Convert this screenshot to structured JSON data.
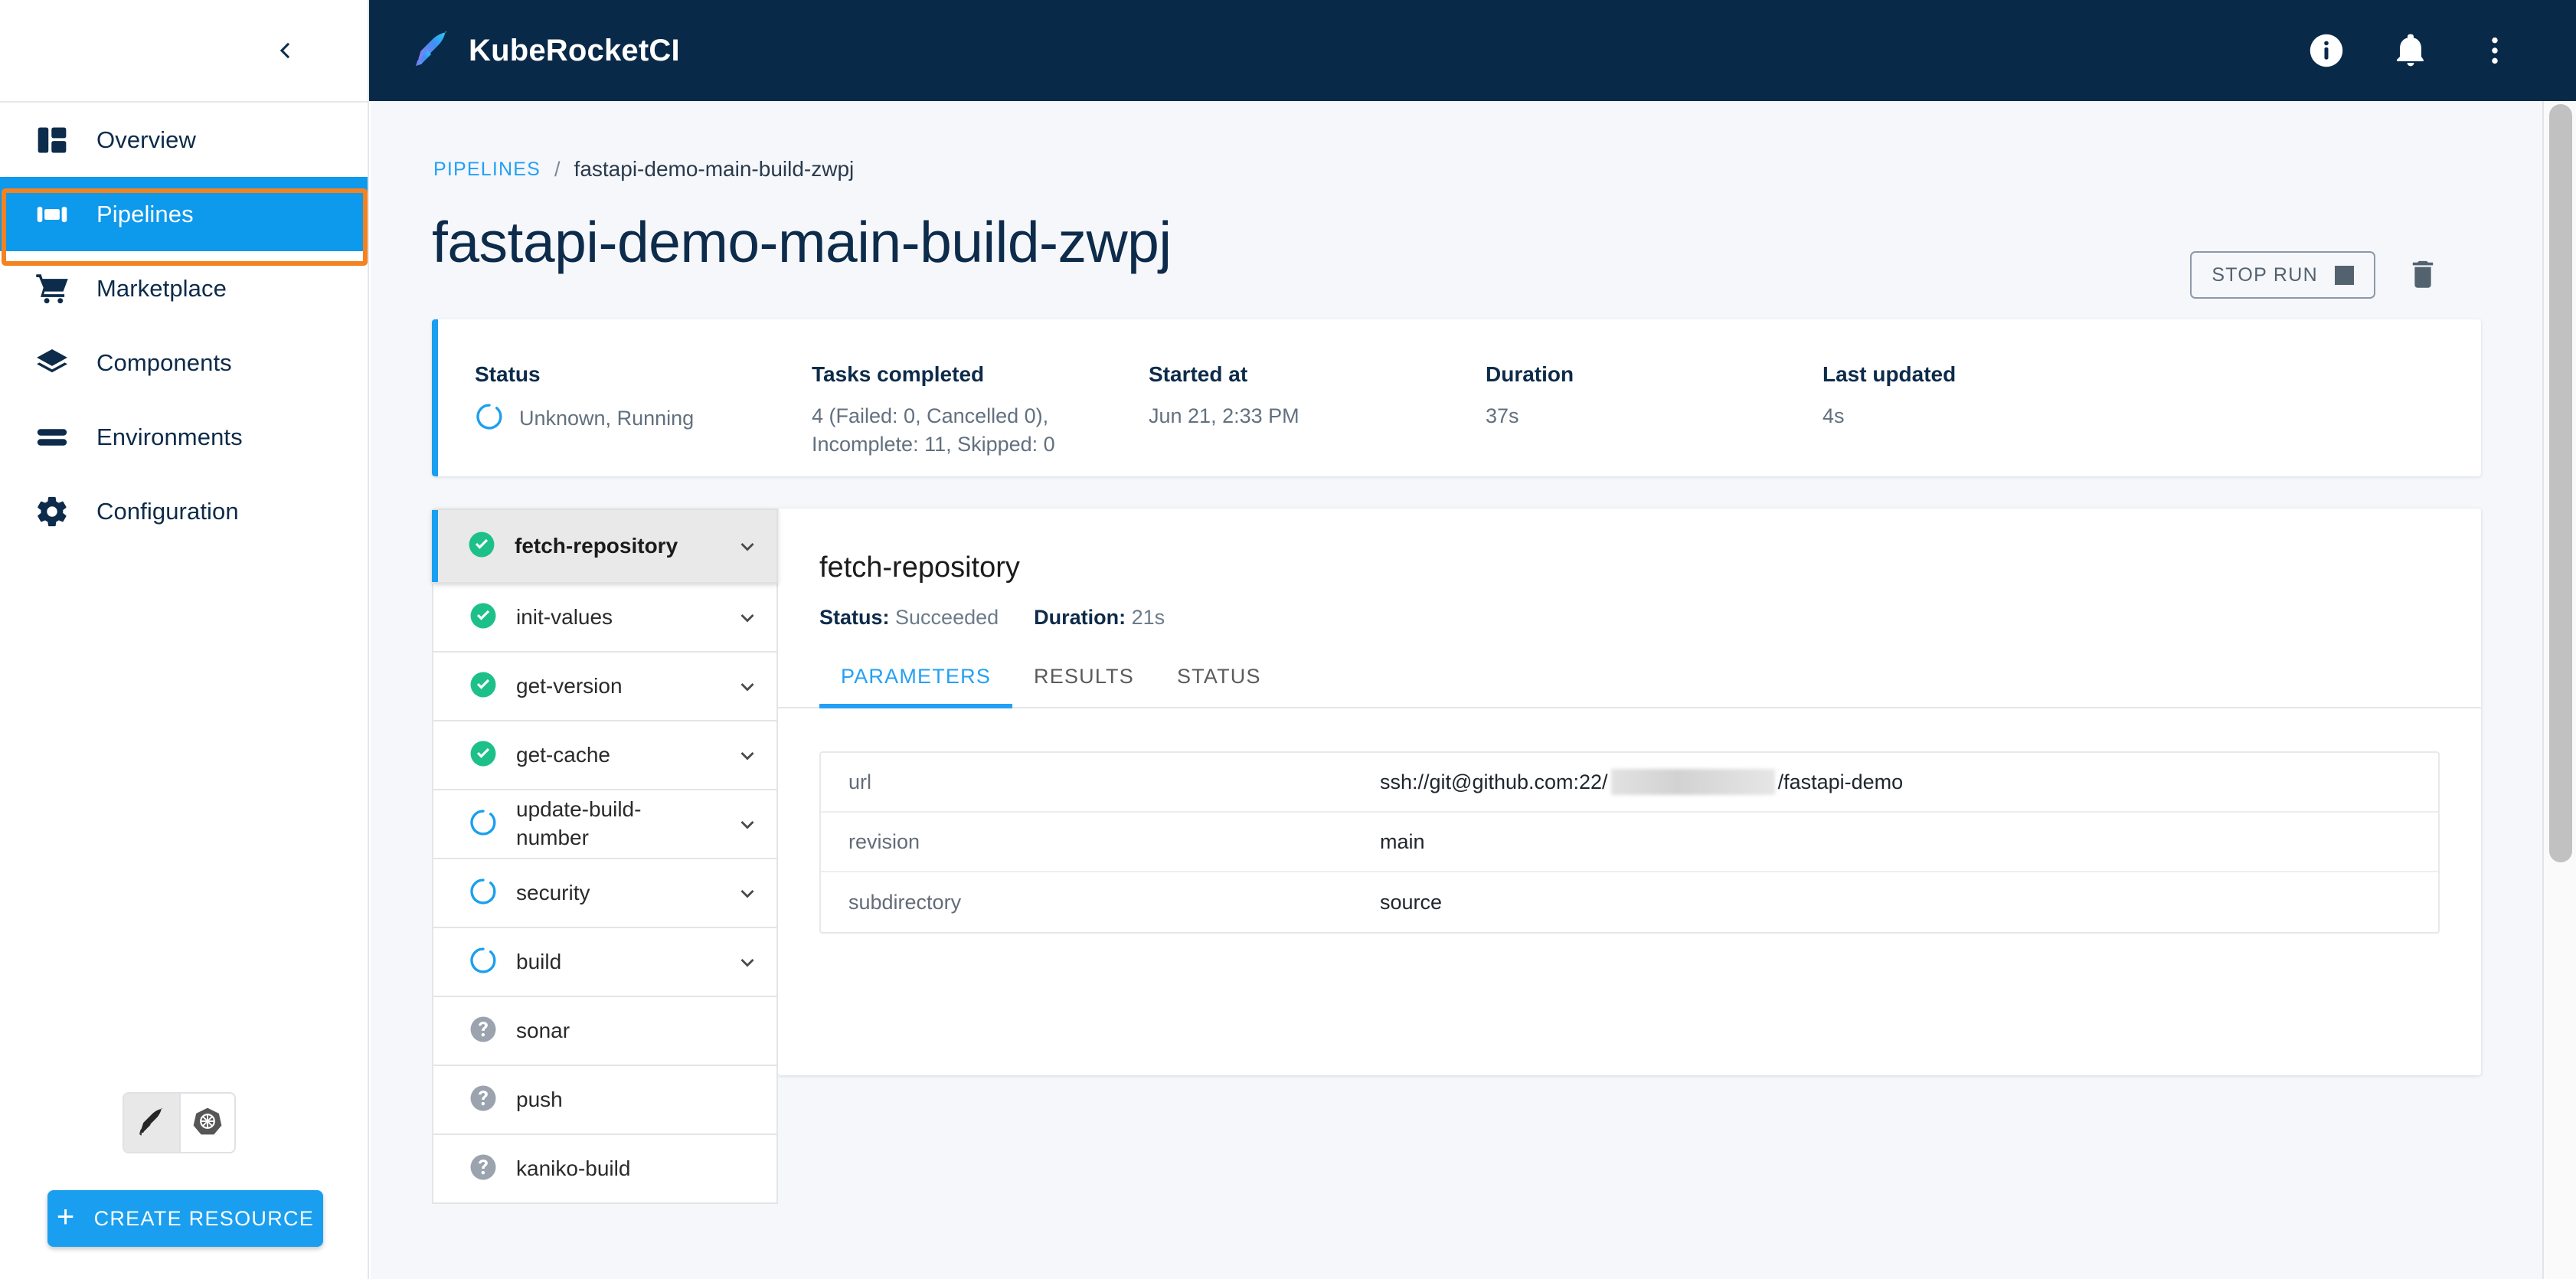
{
  "header": {
    "brand": "KubeRocketCI",
    "icons": [
      "info-icon",
      "notifications-bell-icon",
      "more-vertical-icon"
    ]
  },
  "sidebar": {
    "collapse_icon": "chevron-left-icon",
    "items": [
      {
        "label": "Overview",
        "icon": "dashboard-icon",
        "active": false
      },
      {
        "label": "Pipelines",
        "icon": "pipelines-icon",
        "active": true
      },
      {
        "label": "Marketplace",
        "icon": "shopping-cart-icon",
        "active": false
      },
      {
        "label": "Components",
        "icon": "layers-icon",
        "active": false
      },
      {
        "label": "Environments",
        "icon": "stack-lines-icon",
        "active": false
      },
      {
        "label": "Configuration",
        "icon": "gear-icon",
        "active": false
      }
    ],
    "view_toggle": [
      {
        "icon": "kuberocket-feather-icon",
        "selected": true
      },
      {
        "icon": "kubernetes-helm-icon",
        "selected": false
      }
    ],
    "create_button": {
      "label": "CREATE RESOURCE",
      "icon": "plus-icon"
    },
    "highlight_color": "#f4821f",
    "active_color": "#0d99ec"
  },
  "breadcrumb": {
    "root": "PIPELINES",
    "separator": "/",
    "current": "fastapi-demo-main-build-zwpj"
  },
  "page_title": "fastapi-demo-main-build-zwpj",
  "page_actions": {
    "stop_run": {
      "label": "STOP RUN",
      "icon": "stop-square-icon"
    },
    "delete": {
      "icon": "trash-icon"
    }
  },
  "status_card": {
    "accent_color": "#1a9ff0",
    "fields": [
      {
        "label": "Status",
        "value": "Unknown, Running",
        "icon": "spinner-icon"
      },
      {
        "label": "Tasks completed",
        "value": "4 (Failed: 0, Cancelled 0), Incomplete: 11, Skipped: 0"
      },
      {
        "label": "Started at",
        "value": "Jun 21, 2:33 PM"
      },
      {
        "label": "Duration",
        "value": "37s"
      },
      {
        "label": "Last updated",
        "value": "4s"
      }
    ]
  },
  "task_list": [
    {
      "name": "fetch-repository",
      "status": "succeeded",
      "chevron": true,
      "selected": true
    },
    {
      "name": "init-values",
      "status": "succeeded",
      "chevron": true,
      "selected": false
    },
    {
      "name": "get-version",
      "status": "succeeded",
      "chevron": true,
      "selected": false
    },
    {
      "name": "get-cache",
      "status": "succeeded",
      "chevron": true,
      "selected": false
    },
    {
      "name": "update-build-number",
      "status": "running",
      "chevron": true,
      "selected": false
    },
    {
      "name": "security",
      "status": "running",
      "chevron": true,
      "selected": false
    },
    {
      "name": "build",
      "status": "running",
      "chevron": true,
      "selected": false
    },
    {
      "name": "sonar",
      "status": "unknown",
      "chevron": false,
      "selected": false
    },
    {
      "name": "push",
      "status": "unknown",
      "chevron": false,
      "selected": false
    },
    {
      "name": "kaniko-build",
      "status": "unknown",
      "chevron": false,
      "selected": false
    }
  ],
  "detail": {
    "title": "fetch-repository",
    "status_label": "Status:",
    "status_value": "Succeeded",
    "duration_label": "Duration:",
    "duration_value": "21s",
    "tabs": [
      {
        "label": "PARAMETERS",
        "active": true
      },
      {
        "label": "RESULTS",
        "active": false
      },
      {
        "label": "STATUS",
        "active": false
      }
    ],
    "parameters": [
      {
        "key": "url",
        "value_prefix": "ssh://git@github.com:22/",
        "redacted": true,
        "value_suffix": "/fastapi-demo"
      },
      {
        "key": "revision",
        "value_prefix": "main",
        "redacted": false,
        "value_suffix": ""
      },
      {
        "key": "subdirectory",
        "value_prefix": "source",
        "redacted": false,
        "value_suffix": ""
      }
    ]
  },
  "scrollbar": {
    "orientation": "vertical",
    "thumb_position": "top"
  }
}
